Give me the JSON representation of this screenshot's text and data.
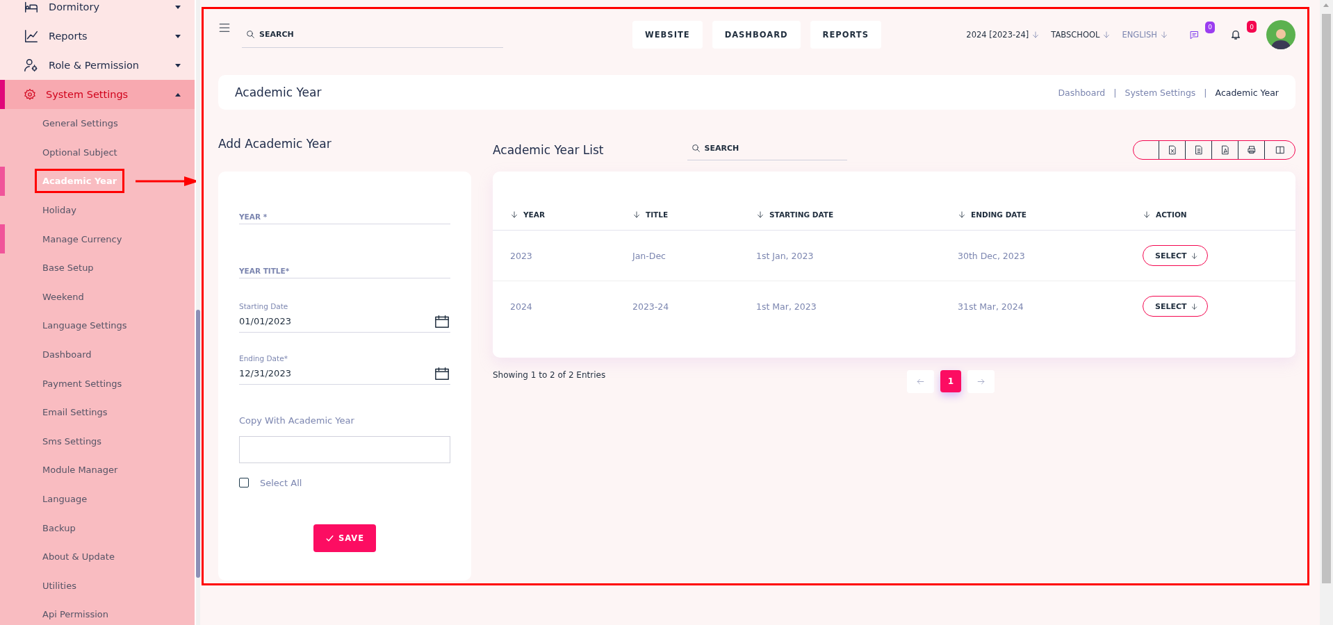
{
  "sidebar": {
    "items": [
      {
        "label": "Dormitory",
        "expanded": false
      },
      {
        "label": "Reports",
        "expanded": false
      },
      {
        "label": "Role & Permission",
        "expanded": false
      },
      {
        "label": "System Settings",
        "expanded": true,
        "children": [
          {
            "label": "General Settings",
            "selected": false,
            "accent": false
          },
          {
            "label": "Optional Subject",
            "selected": false,
            "accent": false
          },
          {
            "label": "Academic Year",
            "selected": true,
            "accent": true
          },
          {
            "label": "Holiday",
            "selected": false,
            "accent": false
          },
          {
            "label": "Manage Currency",
            "selected": false,
            "accent": true
          },
          {
            "label": "Base Setup",
            "selected": false,
            "accent": false
          },
          {
            "label": "Weekend",
            "selected": false,
            "accent": false
          },
          {
            "label": "Language Settings",
            "selected": false,
            "accent": false
          },
          {
            "label": "Dashboard",
            "selected": false,
            "accent": false
          },
          {
            "label": "Payment Settings",
            "selected": false,
            "accent": false
          },
          {
            "label": "Email Settings",
            "selected": false,
            "accent": false
          },
          {
            "label": "Sms Settings",
            "selected": false,
            "accent": false
          },
          {
            "label": "Module Manager",
            "selected": false,
            "accent": false
          },
          {
            "label": "Language",
            "selected": false,
            "accent": false
          },
          {
            "label": "Backup",
            "selected": false,
            "accent": false
          },
          {
            "label": "About & Update",
            "selected": false,
            "accent": false
          },
          {
            "label": "Utilities",
            "selected": false,
            "accent": false
          },
          {
            "label": "Api Permission",
            "selected": false,
            "accent": false
          }
        ]
      }
    ]
  },
  "topbar": {
    "search": {
      "placeholder": "SEARCH"
    },
    "nav": [
      "WEBSITE",
      "DASHBOARD",
      "REPORTS"
    ],
    "session": "2024 [2023-24]",
    "school": "TABSCHOOL",
    "language": "ENGLISH",
    "messages_badge": "0",
    "notifications_badge": "0"
  },
  "page_header": {
    "title": "Academic Year",
    "breadcrumb": [
      {
        "label": "Dashboard",
        "current": false
      },
      {
        "label": "System Settings",
        "current": false
      },
      {
        "label": "Academic Year",
        "current": true
      }
    ],
    "separators": [
      "|",
      "|"
    ]
  },
  "form": {
    "title": "Add Academic Year",
    "fields": [
      {
        "kind": "text",
        "placeholder": "YEAR *"
      },
      {
        "kind": "text",
        "placeholder": "YEAR TITLE*"
      },
      {
        "kind": "date",
        "label": "Starting Date",
        "value": "01/01/2023"
      },
      {
        "kind": "date",
        "label": "Ending Date*",
        "value": "12/31/2023"
      }
    ],
    "copy_label": "Copy With Academic Year",
    "select_all": {
      "label": "Select All",
      "checked": false
    },
    "save": "SAVE"
  },
  "list": {
    "title": "Academic Year List",
    "search": {
      "placeholder": "SEARCH"
    },
    "table": {
      "columns": [
        "YEAR",
        "TITLE",
        "STARTING DATE",
        "ENDING DATE",
        "ACTION"
      ],
      "rows": [
        {
          "year": "2023",
          "title": "Jan-Dec",
          "start": "1st Jan, 2023",
          "end": "30th Dec, 2023",
          "action": "SELECT"
        },
        {
          "year": "2024",
          "title": "2023-24",
          "start": "1st Mar, 2023",
          "end": "31st Mar, 2024",
          "action": "SELECT"
        }
      ]
    },
    "info": "Showing 1 to 2 of 2 Entries",
    "pages": [
      {
        "label": "1",
        "selected": true
      }
    ]
  }
}
